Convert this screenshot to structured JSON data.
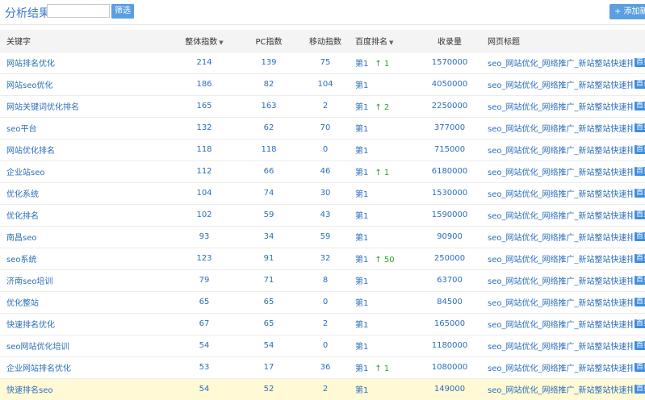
{
  "header": {
    "title": "分析结果",
    "filter_button": "筛选",
    "add_button": "+ 添加新词",
    "filter_placeholder": ""
  },
  "columns": {
    "keyword": "关键字",
    "overall": "整体指数",
    "pc": "PC指数",
    "mobile": "移动指数",
    "baidu": "百度排名",
    "indexed": "收录量",
    "page_title": "网页标题",
    "sort_arrow": "▼"
  },
  "rows": [
    {
      "keyword": "网站排名优化",
      "overall": "214",
      "pc": "139",
      "mobile": "75",
      "rank": "第1",
      "change": "↑ 1",
      "indexed": "1570000",
      "page_title": "seo_网站优化_网络推广_新站整站快速排名_",
      "tag": "首页"
    },
    {
      "keyword": "网站seo优化",
      "overall": "186",
      "pc": "82",
      "mobile": "104",
      "rank": "第1",
      "change": "",
      "indexed": "4050000",
      "page_title": "seo_网站优化_网络推广_新站整站快速排名_",
      "tag": "首页"
    },
    {
      "keyword": "网站关键词优化排名",
      "overall": "165",
      "pc": "163",
      "mobile": "2",
      "rank": "第1",
      "change": "↑ 2",
      "indexed": "2250000",
      "page_title": "seo_网站优化_网络推广_新站整站快速排名_",
      "tag": "首页"
    },
    {
      "keyword": "seo平台",
      "overall": "132",
      "pc": "62",
      "mobile": "70",
      "rank": "第1",
      "change": "",
      "indexed": "377000",
      "page_title": "seo_网站优化_网络推广_新站整站快速排名_",
      "tag": "首页"
    },
    {
      "keyword": "网站优化排名",
      "overall": "118",
      "pc": "118",
      "mobile": "0",
      "rank": "第1",
      "change": "",
      "indexed": "715000",
      "page_title": "seo_网站优化_网络推广_新站整站快速排名_",
      "tag": "首页"
    },
    {
      "keyword": "企业站seo",
      "overall": "112",
      "pc": "66",
      "mobile": "46",
      "rank": "第1",
      "change": "↑ 1",
      "indexed": "6180000",
      "page_title": "seo_网站优化_网络推广_新站整站快速排名_",
      "tag": "首页"
    },
    {
      "keyword": "优化系统",
      "overall": "104",
      "pc": "74",
      "mobile": "30",
      "rank": "第1",
      "change": "",
      "indexed": "1530000",
      "page_title": "seo_网站优化_网络推广_新站整站快速排名_",
      "tag": "首页"
    },
    {
      "keyword": "优化排名",
      "overall": "102",
      "pc": "59",
      "mobile": "43",
      "rank": "第1",
      "change": "",
      "indexed": "1590000",
      "page_title": "seo_网站优化_网络推广_新站整站快速排名_",
      "tag": "首页"
    },
    {
      "keyword": "南昌seo",
      "overall": "93",
      "pc": "34",
      "mobile": "59",
      "rank": "第1",
      "change": "",
      "indexed": "90900",
      "page_title": "seo_网站优化_网络推广_新站整站快速排名_",
      "tag": "首页"
    },
    {
      "keyword": "seo系统",
      "overall": "123",
      "pc": "91",
      "mobile": "32",
      "rank": "第1",
      "change": "↑ 50",
      "indexed": "250000",
      "page_title": "seo_网站优化_网络推广_新站整站快速排名_",
      "tag": "首页"
    },
    {
      "keyword": "济南seo培训",
      "overall": "79",
      "pc": "71",
      "mobile": "8",
      "rank": "第1",
      "change": "",
      "indexed": "63700",
      "page_title": "seo_网站优化_网络推广_新站整站快速排名_",
      "tag": "首页"
    },
    {
      "keyword": "优化整站",
      "overall": "65",
      "pc": "65",
      "mobile": "0",
      "rank": "第1",
      "change": "",
      "indexed": "84500",
      "page_title": "seo_网站优化_网络推广_新站整站快速排名_",
      "tag": "首页"
    },
    {
      "keyword": "快速排名优化",
      "overall": "67",
      "pc": "65",
      "mobile": "2",
      "rank": "第1",
      "change": "",
      "indexed": "165000",
      "page_title": "seo_网站优化_网络推广_新站整站快速排名_",
      "tag": "首页"
    },
    {
      "keyword": "seo网站优化培训",
      "overall": "54",
      "pc": "54",
      "mobile": "0",
      "rank": "第1",
      "change": "",
      "indexed": "1180000",
      "page_title": "seo_网站优化_网络推广_新站整站快速排名_",
      "tag": "首页"
    },
    {
      "keyword": "企业网站排名优化",
      "overall": "53",
      "pc": "17",
      "mobile": "36",
      "rank": "第1",
      "change": "↑ 1",
      "indexed": "1080000",
      "page_title": "seo_网站优化_网络推广_新站整站快速排名_",
      "tag": "首页"
    },
    {
      "keyword": "快速排名seo",
      "overall": "54",
      "pc": "52",
      "mobile": "2",
      "rank": "第1",
      "change": "",
      "indexed": "149000",
      "page_title": "seo_网站优化_网络推广_新站整站快速排名_",
      "tag": "首页",
      "highlight": true
    }
  ]
}
